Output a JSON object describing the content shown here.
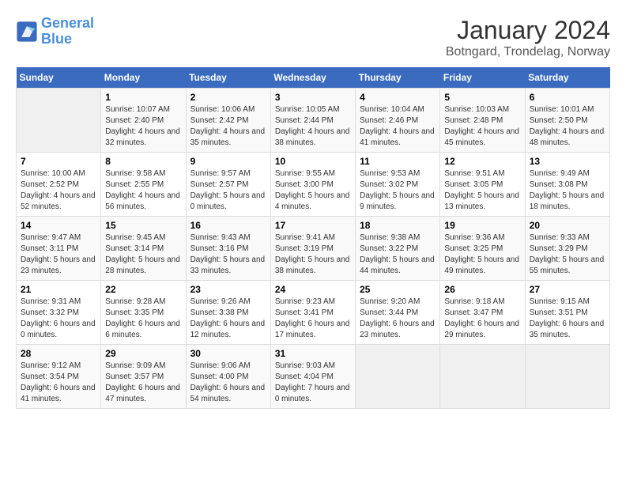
{
  "logo": {
    "text_general": "General",
    "text_blue": "Blue"
  },
  "title": "January 2024",
  "subtitle": "Botngard, Trondelag, Norway",
  "days_header": [
    "Sunday",
    "Monday",
    "Tuesday",
    "Wednesday",
    "Thursday",
    "Friday",
    "Saturday"
  ],
  "weeks": [
    [
      {
        "day": "",
        "empty": true
      },
      {
        "day": "1",
        "sunrise": "Sunrise: 10:07 AM",
        "sunset": "Sunset: 2:40 PM",
        "daylight": "Daylight: 4 hours and 32 minutes."
      },
      {
        "day": "2",
        "sunrise": "Sunrise: 10:06 AM",
        "sunset": "Sunset: 2:42 PM",
        "daylight": "Daylight: 4 hours and 35 minutes."
      },
      {
        "day": "3",
        "sunrise": "Sunrise: 10:05 AM",
        "sunset": "Sunset: 2:44 PM",
        "daylight": "Daylight: 4 hours and 38 minutes."
      },
      {
        "day": "4",
        "sunrise": "Sunrise: 10:04 AM",
        "sunset": "Sunset: 2:46 PM",
        "daylight": "Daylight: 4 hours and 41 minutes."
      },
      {
        "day": "5",
        "sunrise": "Sunrise: 10:03 AM",
        "sunset": "Sunset: 2:48 PM",
        "daylight": "Daylight: 4 hours and 45 minutes."
      },
      {
        "day": "6",
        "sunrise": "Sunrise: 10:01 AM",
        "sunset": "Sunset: 2:50 PM",
        "daylight": "Daylight: 4 hours and 48 minutes."
      }
    ],
    [
      {
        "day": "7",
        "sunrise": "Sunrise: 10:00 AM",
        "sunset": "Sunset: 2:52 PM",
        "daylight": "Daylight: 4 hours and 52 minutes."
      },
      {
        "day": "8",
        "sunrise": "Sunrise: 9:58 AM",
        "sunset": "Sunset: 2:55 PM",
        "daylight": "Daylight: 4 hours and 56 minutes."
      },
      {
        "day": "9",
        "sunrise": "Sunrise: 9:57 AM",
        "sunset": "Sunset: 2:57 PM",
        "daylight": "Daylight: 5 hours and 0 minutes."
      },
      {
        "day": "10",
        "sunrise": "Sunrise: 9:55 AM",
        "sunset": "Sunset: 3:00 PM",
        "daylight": "Daylight: 5 hours and 4 minutes."
      },
      {
        "day": "11",
        "sunrise": "Sunrise: 9:53 AM",
        "sunset": "Sunset: 3:02 PM",
        "daylight": "Daylight: 5 hours and 9 minutes."
      },
      {
        "day": "12",
        "sunrise": "Sunrise: 9:51 AM",
        "sunset": "Sunset: 3:05 PM",
        "daylight": "Daylight: 5 hours and 13 minutes."
      },
      {
        "day": "13",
        "sunrise": "Sunrise: 9:49 AM",
        "sunset": "Sunset: 3:08 PM",
        "daylight": "Daylight: 5 hours and 18 minutes."
      }
    ],
    [
      {
        "day": "14",
        "sunrise": "Sunrise: 9:47 AM",
        "sunset": "Sunset: 3:11 PM",
        "daylight": "Daylight: 5 hours and 23 minutes."
      },
      {
        "day": "15",
        "sunrise": "Sunrise: 9:45 AM",
        "sunset": "Sunset: 3:14 PM",
        "daylight": "Daylight: 5 hours and 28 minutes."
      },
      {
        "day": "16",
        "sunrise": "Sunrise: 9:43 AM",
        "sunset": "Sunset: 3:16 PM",
        "daylight": "Daylight: 5 hours and 33 minutes."
      },
      {
        "day": "17",
        "sunrise": "Sunrise: 9:41 AM",
        "sunset": "Sunset: 3:19 PM",
        "daylight": "Daylight: 5 hours and 38 minutes."
      },
      {
        "day": "18",
        "sunrise": "Sunrise: 9:38 AM",
        "sunset": "Sunset: 3:22 PM",
        "daylight": "Daylight: 5 hours and 44 minutes."
      },
      {
        "day": "19",
        "sunrise": "Sunrise: 9:36 AM",
        "sunset": "Sunset: 3:25 PM",
        "daylight": "Daylight: 5 hours and 49 minutes."
      },
      {
        "day": "20",
        "sunrise": "Sunrise: 9:33 AM",
        "sunset": "Sunset: 3:29 PM",
        "daylight": "Daylight: 5 hours and 55 minutes."
      }
    ],
    [
      {
        "day": "21",
        "sunrise": "Sunrise: 9:31 AM",
        "sunset": "Sunset: 3:32 PM",
        "daylight": "Daylight: 6 hours and 0 minutes."
      },
      {
        "day": "22",
        "sunrise": "Sunrise: 9:28 AM",
        "sunset": "Sunset: 3:35 PM",
        "daylight": "Daylight: 6 hours and 6 minutes."
      },
      {
        "day": "23",
        "sunrise": "Sunrise: 9:26 AM",
        "sunset": "Sunset: 3:38 PM",
        "daylight": "Daylight: 6 hours and 12 minutes."
      },
      {
        "day": "24",
        "sunrise": "Sunrise: 9:23 AM",
        "sunset": "Sunset: 3:41 PM",
        "daylight": "Daylight: 6 hours and 17 minutes."
      },
      {
        "day": "25",
        "sunrise": "Sunrise: 9:20 AM",
        "sunset": "Sunset: 3:44 PM",
        "daylight": "Daylight: 6 hours and 23 minutes."
      },
      {
        "day": "26",
        "sunrise": "Sunrise: 9:18 AM",
        "sunset": "Sunset: 3:47 PM",
        "daylight": "Daylight: 6 hours and 29 minutes."
      },
      {
        "day": "27",
        "sunrise": "Sunrise: 9:15 AM",
        "sunset": "Sunset: 3:51 PM",
        "daylight": "Daylight: 6 hours and 35 minutes."
      }
    ],
    [
      {
        "day": "28",
        "sunrise": "Sunrise: 9:12 AM",
        "sunset": "Sunset: 3:54 PM",
        "daylight": "Daylight: 6 hours and 41 minutes."
      },
      {
        "day": "29",
        "sunrise": "Sunrise: 9:09 AM",
        "sunset": "Sunset: 3:57 PM",
        "daylight": "Daylight: 6 hours and 47 minutes."
      },
      {
        "day": "30",
        "sunrise": "Sunrise: 9:06 AM",
        "sunset": "Sunset: 4:00 PM",
        "daylight": "Daylight: 6 hours and 54 minutes."
      },
      {
        "day": "31",
        "sunrise": "Sunrise: 9:03 AM",
        "sunset": "Sunset: 4:04 PM",
        "daylight": "Daylight: 7 hours and 0 minutes."
      },
      {
        "day": "",
        "empty": true
      },
      {
        "day": "",
        "empty": true
      },
      {
        "day": "",
        "empty": true
      }
    ]
  ]
}
